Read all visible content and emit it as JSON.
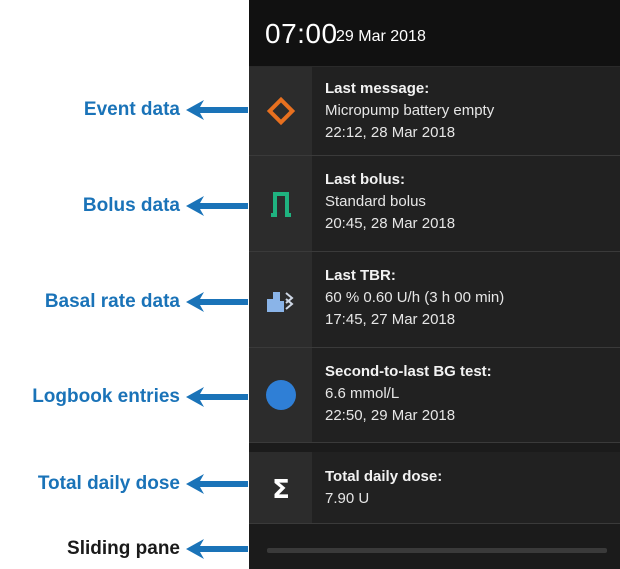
{
  "status": {
    "time": "07:00",
    "date": "29 Mar 2018"
  },
  "rows": [
    {
      "icon": "diamond-icon",
      "title": "Last message:",
      "line1": "Micropump battery empty",
      "line2": "22:12, 28 Mar 2018"
    },
    {
      "icon": "bolus-pulse-icon",
      "title": "Last bolus:",
      "line1": "Standard bolus",
      "line2": "20:45, 28 Mar 2018"
    },
    {
      "icon": "basal-rate-icon",
      "title": "Last TBR:",
      "line1": "60 % 0.60 U/h (3 h 00 min)",
      "line2": "17:45, 27 Mar 2018"
    },
    {
      "icon": "blue-circle-icon",
      "title": "Second-to-last BG test:",
      "line1": "6.6 mmol/L",
      "line2": "22:50, 29 Mar 2018"
    },
    {
      "icon": "sigma-icon",
      "title": "Total daily dose:",
      "line1": "7.90 U"
    }
  ],
  "annotations": {
    "event": "Event data",
    "bolus": "Bolus data",
    "basal": "Basal rate data",
    "logbook": "Logbook entries",
    "total": "Total daily dose",
    "sliding": "Sliding pane"
  },
  "colors": {
    "accent_blue": "#1a73b8",
    "orange": "#e8701f",
    "green": "#1fb380",
    "dot_blue": "#2f7fd6"
  }
}
